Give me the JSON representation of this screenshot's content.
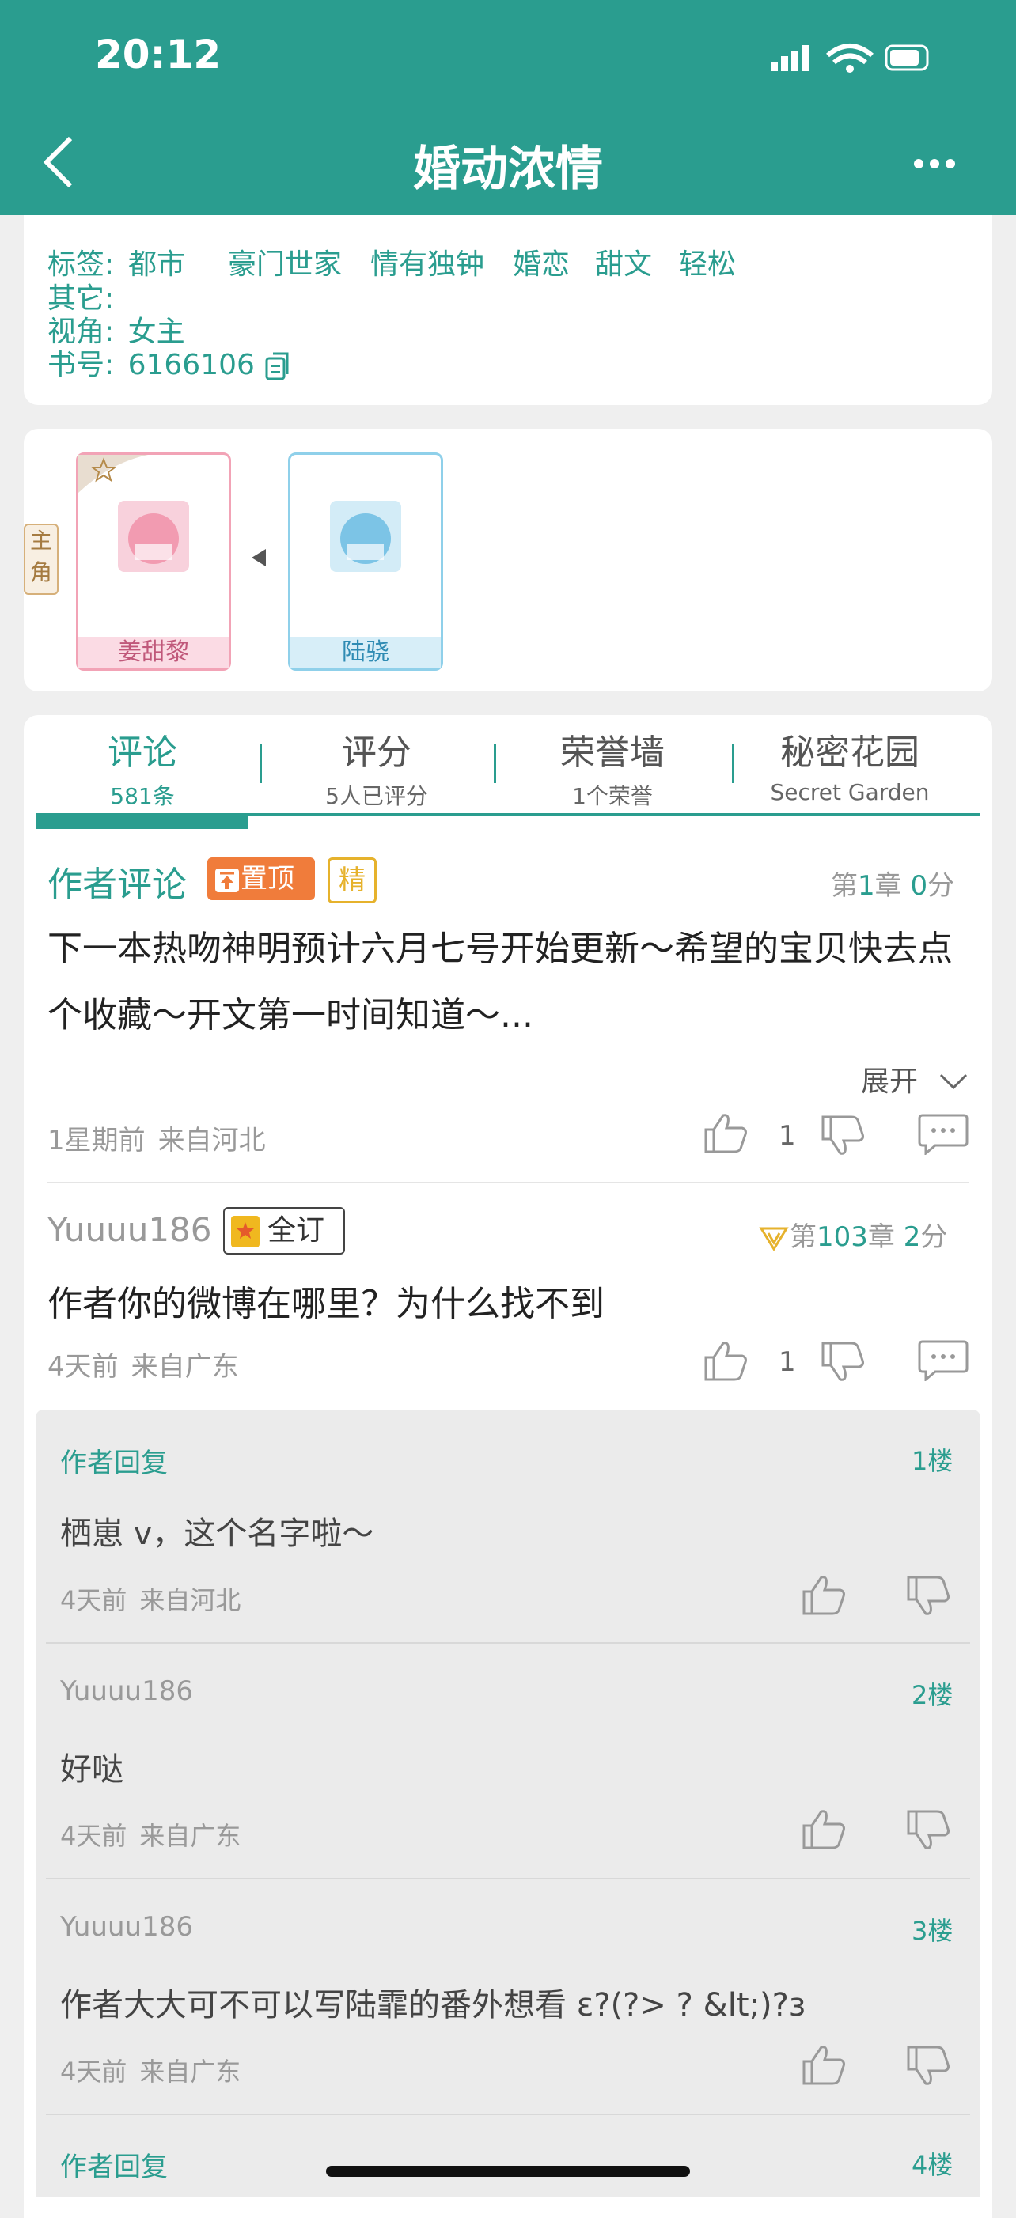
{
  "status": {
    "time": "20:12"
  },
  "nav": {
    "title": "婚动浓情"
  },
  "info": {
    "tags_label": "标签:",
    "tags": [
      "都市",
      "豪门世家",
      "情有独钟",
      "婚恋",
      "甜文",
      "轻松"
    ],
    "other_label": "其它:",
    "view_label": "视角:",
    "view_value": "女主",
    "book_label": "书号:",
    "book_value": "6166106"
  },
  "roles": {
    "side_label_1": "主",
    "side_label_2": "角",
    "female": "姜甜黎",
    "male": "陆骁"
  },
  "tabs": [
    {
      "label": "评论",
      "sub": "581条"
    },
    {
      "label": "评分",
      "sub": "5人已评分"
    },
    {
      "label": "荣誉墙",
      "sub": "1个荣誉"
    },
    {
      "label": "秘密花园",
      "sub": "Secret Garden"
    }
  ],
  "author_comment": {
    "title": "作者评论",
    "pin_badge": "置顶",
    "featured_badge": "精",
    "chapter_prefix": "第",
    "chapter": "1",
    "chapter_suffix": "章",
    "score": "0",
    "score_suffix": "分",
    "text": "下一本热吻神明预计六月七号开始更新～希望的宝贝快去点个收藏～开文第一时间知道～...",
    "expand": "展开",
    "time": "1星期前",
    "from": "来自河北",
    "likes": "1"
  },
  "user_comment": {
    "user": "Yuuuu186",
    "badge": "全订",
    "chapter_prefix": "第",
    "chapter": "103",
    "chapter_suffix": "章",
    "score": "2",
    "score_suffix": "分",
    "text": "作者你的微博在哪里？为什么找不到",
    "time": "4天前",
    "from": "来自广东",
    "likes": "1"
  },
  "replies": [
    {
      "user": "作者回复",
      "floor": "1楼",
      "text": "栖崽 v，这个名字啦～",
      "time": "4天前",
      "from": "来自河北"
    },
    {
      "user": "Yuuuu186",
      "floor": "2楼",
      "text": "好哒",
      "time": "4天前",
      "from": "来自广东"
    },
    {
      "user": "Yuuuu186",
      "floor": "3楼",
      "text": "作者大大可不可以写陆霏的番外想看 ε?(?> ? &lt;)?з",
      "time": "4天前",
      "from": "来自广东"
    },
    {
      "user": "作者回复",
      "floor": "4楼"
    }
  ],
  "colors": {
    "accent": "#2a9d8f",
    "pin": "#f07c3b",
    "featured": "#e6b22c"
  }
}
